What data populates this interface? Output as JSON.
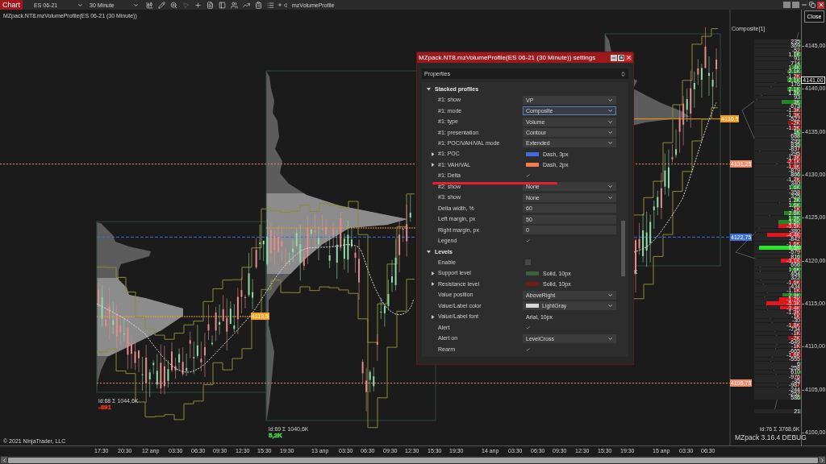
{
  "toolbar": {
    "tab": "Chart",
    "instrument": "ES 06-21",
    "interval": "30 Minute",
    "indicator": "mzVolumeProfile"
  },
  "close_button": "Close",
  "chart": {
    "indicator_label": "MZpack.NT8.mzVolumeProfile(ES 06-21 (30 Minute))",
    "composite_label": "Composite[1]",
    "price_tags": [
      {
        "text": "4136,5",
        "color": "#f39a1e"
      },
      {
        "text": "4131,25",
        "color": "#f08a6a"
      },
      {
        "text": "4122,75",
        "color": "#3d6fd6"
      },
      {
        "text": "4113,5",
        "color": "#f5a21c"
      },
      {
        "text": "4105,75",
        "color": "#f08a6a"
      }
    ],
    "profile_stats": [
      {
        "summary": "ld:68 Σ 1044,6K",
        "delta": "-891",
        "color": "#e0301e"
      },
      {
        "summary": "ld:69 Σ 1040,6K",
        "delta": "5,2K",
        "color": "#3ddc3d"
      },
      {
        "summary": "K"
      },
      {
        "summary": "ld:76 Σ 3768,6K"
      }
    ],
    "delta_column": [
      {
        "value": "235",
        "color": "#1a5c1a",
        "level": 0.04
      },
      {
        "value": "369",
        "color": "#1a5c1a",
        "level": 0.05
      },
      {
        "value": "-52",
        "color": "#5e1416",
        "level": 0.04
      },
      {
        "value": "1.1K",
        "color": "#1f8a1f",
        "level": 0.15
      },
      {
        "value": "91",
        "color": "#1a5c1a",
        "level": 0.04
      },
      {
        "value": "714",
        "color": "#1a5c1a",
        "level": 0.1
      },
      {
        "value": "1.4K",
        "color": "#1f8a1f",
        "level": 0.2
      },
      {
        "value": "2.1K",
        "color": "#1f8a1f",
        "level": 0.29
      },
      {
        "value": "-1.2K",
        "color": "#9c1518",
        "level": 0.16
      },
      {
        "value": "2.1K",
        "color": "#1f8a1f",
        "level": 0.29
      },
      {
        "value": "176",
        "color": "#1a5c1a",
        "level": 0.04
      },
      {
        "value": "2.1K",
        "color": "#1f8a1f",
        "level": 0.29
      },
      {
        "value": "1.2K",
        "color": "#1f8a1f",
        "level": 0.16
      },
      {
        "value": "93",
        "color": "#1a5c1a",
        "level": 0.04
      },
      {
        "value": "3K",
        "color": "#1f8a1f",
        "level": 0.41
      },
      {
        "value": "673",
        "color": "#1a5c1a",
        "level": 0.09
      },
      {
        "value": "-1.3K",
        "color": "#9c1518",
        "level": 0.18
      },
      {
        "value": "-1.3K",
        "color": "#9c1518",
        "level": 0.18
      },
      {
        "value": "-522",
        "color": "#5e1416",
        "level": 0.07
      },
      {
        "value": "-2K",
        "color": "#9c1518",
        "level": 0.28
      },
      {
        "value": "-1.5K",
        "color": "#9c1518",
        "level": 0.21
      },
      {
        "value": "1K",
        "color": "#1f8a1f",
        "level": 0.14
      },
      {
        "value": "688",
        "color": "#1a5c1a",
        "level": 0.1
      },
      {
        "value": "299",
        "color": "#1a5c1a",
        "level": 0.05
      },
      {
        "value": "835",
        "color": "#1a5c1a",
        "level": 0.12
      },
      {
        "value": "-837",
        "color": "#5e1416",
        "level": 0.12
      },
      {
        "value": "-295",
        "color": "#5e1416",
        "level": 0.05
      },
      {
        "value": "-1.3K",
        "color": "#9c1518",
        "level": 0.18
      },
      {
        "value": "-2.1K",
        "color": "#9c1518",
        "level": 0.29
      },
      {
        "value": "-1.9K",
        "color": "#9c1518",
        "level": 0.26
      },
      {
        "value": "-879",
        "color": "#5e1416",
        "level": 0.13
      },
      {
        "value": "866",
        "color": "#1a5c1a",
        "level": 0.12
      },
      {
        "value": "-1.2K",
        "color": "#9c1518",
        "level": 0.16
      },
      {
        "value": "340",
        "color": "#1a5c1a",
        "level": 0.05
      },
      {
        "value": "1.6K",
        "color": "#1f8a1f",
        "level": 0.23
      },
      {
        "value": "-358",
        "color": "#5e1416",
        "level": 0.05
      },
      {
        "value": "325",
        "color": "#1a5c1a",
        "level": 0.05
      },
      {
        "value": "1.2K",
        "color": "#1f8a1f",
        "level": 0.16
      },
      {
        "value": "1.6K",
        "color": "#1f8a1f",
        "level": 0.23
      },
      {
        "value": "-1K",
        "color": "#9c1518",
        "level": 0.14
      },
      {
        "value": "2.6K",
        "color": "#1f8a1f",
        "level": 0.36
      },
      {
        "value": "1.9K",
        "color": "#1f8a1f",
        "level": 0.26
      },
      {
        "value": "3.5K",
        "color": "#1f8a1f",
        "level": 0.49
      },
      {
        "value": "-3.5K",
        "color": "#e3161e",
        "level": 0.49
      },
      {
        "value": "-380",
        "color": "#5e1416",
        "level": 0.05
      },
      {
        "value": "-4.4K",
        "color": "#e3161e",
        "level": 0.72
      },
      {
        "value": "-842",
        "color": "#5e1416",
        "level": 0.12
      },
      {
        "value": "-1.6K",
        "color": "#9c1518",
        "level": 0.23
      },
      {
        "value": "6.5K",
        "color": "#27e627",
        "level": 0.9
      },
      {
        "value": "-579",
        "color": "#5e1416",
        "level": 0.08
      },
      {
        "value": "816",
        "color": "#1a5c1a",
        "level": 0.12
      },
      {
        "value": "-3.1K",
        "color": "#e3161e",
        "level": 0.43
      },
      {
        "value": "666",
        "color": "#1a5c1a",
        "level": 0.09
      },
      {
        "value": "1.6K",
        "color": "#1f8a1f",
        "level": 0.23
      },
      {
        "value": "454",
        "color": "#1a5c1a",
        "level": 0.06
      },
      {
        "value": "322",
        "color": "#1a5c1a",
        "level": 0.05
      },
      {
        "value": "-1.6K",
        "color": "#9c1518",
        "level": 0.23
      },
      {
        "value": "-434",
        "color": "#5e1416",
        "level": 0.06
      },
      {
        "value": "-1.1K",
        "color": "#9c1518",
        "level": 0.15
      },
      {
        "value": "2.9K",
        "color": "#1f8a1f",
        "level": 0.4
      },
      {
        "value": "-1.7K",
        "color": "#e3161e",
        "level": 0.47
      },
      {
        "value": "-5.3K",
        "color": "#e3161e",
        "level": 0.74
      },
      {
        "value": "-3.4K",
        "color": "#e3161e",
        "level": 0.45
      },
      {
        "value": "-1.3K",
        "color": "#9c1518",
        "level": 0.18
      },
      {
        "value": "-1K",
        "color": "#9c1518",
        "level": 0.14
      },
      {
        "value": "-30",
        "color": "#5e1416",
        "level": 0.04
      },
      {
        "value": "-1.8K",
        "color": "#9c1518",
        "level": 0.25
      },
      {
        "value": "-734",
        "color": "#5e1416",
        "level": 0.1
      },
      {
        "value": "-1K",
        "color": "#9c1518",
        "level": 0.14
      },
      {
        "value": "-2K",
        "color": "#9c1518",
        "level": 0.28
      },
      {
        "value": "-649",
        "color": "#5e1416",
        "level": 0.09
      },
      {
        "value": "-1K",
        "color": "#9c1518",
        "level": 0.14
      },
      {
        "value": "-665",
        "color": "#5e1416",
        "level": 0.09
      },
      {
        "value": "-1.6K",
        "color": "#9c1518",
        "level": 0.23
      },
      {
        "value": "-555",
        "color": "#5e1416",
        "level": 0.08
      },
      {
        "value": "6",
        "color": "#1a5c1a",
        "level": 0.04
      },
      {
        "value": "-258",
        "color": "#5e1416",
        "level": 0.04
      },
      {
        "value": "610",
        "color": "#1a5c1a",
        "level": 0.08
      },
      {
        "value": "-976",
        "color": "#5e1416",
        "level": 0.13
      },
      {
        "value": "-35",
        "color": "#5e1416",
        "level": 0.04
      },
      {
        "value": "-987",
        "color": "#5e1416",
        "level": 0.13
      },
      {
        "value": "-244",
        "color": "#5e1416",
        "level": 0.04
      },
      {
        "value": "-252",
        "color": "#5e1416",
        "level": 0.04
      },
      {
        "value": "586",
        "color": "#1a5c1a",
        "level": 0.08
      }
    ],
    "delta_column_tail": [
      {
        "value": "21",
        "color": "#1a5c1a",
        "level": 0.04
      }
    ],
    "copyright": "© 2021 NinjaTrader, LLC",
    "version": "MZpack 3.16.4 DEBUG"
  },
  "price_axis": {
    "labels": [
      "4145,00",
      "4140,00",
      "4135,00",
      "4130,00",
      "4125,00",
      "4120,00",
      "4115,00",
      "4110,00",
      "4105,00",
      "4100,00"
    ],
    "current_price": "4141,00"
  },
  "time_axis": {
    "labels": [
      "17:30",
      "20:30",
      "12 апр",
      "03:30",
      "06:30",
      "09:30",
      "12:30",
      "15:30",
      "19:30",
      "13 апр",
      "03:30",
      "06:30",
      "09:30",
      "12:30",
      "15:30",
      "19:30",
      "14 апр",
      "03:30",
      "06:30",
      "09:30",
      "12:30",
      "15:30",
      "19:30",
      "15 апр",
      "03:30",
      "06:30"
    ]
  },
  "settings": {
    "title": "MZpack.NT8.mzVolumeProfile(ES 06-21 (30 Minute)) settings",
    "header": "Properties",
    "groups": [
      {
        "label": "Stacked profiles",
        "expanded": true,
        "rows": [
          {
            "kind": "dropdown",
            "label": "#1: show",
            "value": "VP",
            "focused": false
          },
          {
            "kind": "dropdown",
            "label": "#1: mode",
            "value": "Composite",
            "focused": true
          },
          {
            "kind": "dropdown",
            "label": "#1: type",
            "value": "Volume",
            "focused": false
          },
          {
            "kind": "dropdown",
            "label": "#1: presentation",
            "value": "Contour",
            "focused": false
          },
          {
            "kind": "dropdown",
            "label": "#1: POC/VAH/VAL mode",
            "value": "Extended",
            "focused": false
          },
          {
            "kind": "stroke",
            "label": "#1: POC",
            "value": "Dash, 3px",
            "color": "#3b6ee0",
            "expanded": false,
            "focused": false
          },
          {
            "kind": "stroke",
            "label": "#1: VAH/VAL",
            "value": "Dash, 2px",
            "color": "#f47c50",
            "expanded": false,
            "focused": false
          },
          {
            "kind": "checkbox",
            "label": "#1: Delta",
            "checked": true,
            "focused": false
          },
          {
            "kind": "dropdown",
            "label": "#2: show",
            "value": "None",
            "focused": false
          },
          {
            "kind": "dropdown",
            "label": "#3: show",
            "value": "None",
            "focused": false
          },
          {
            "kind": "number",
            "label": "Delta width, %",
            "value": "60",
            "focused": false
          },
          {
            "kind": "number",
            "label": "Left margin, px",
            "value": "50",
            "focused": false
          },
          {
            "kind": "number",
            "label": "Right margin, px",
            "value": "0",
            "focused": false
          },
          {
            "kind": "checkbox",
            "label": "Legend",
            "checked": true,
            "focused": false
          }
        ]
      },
      {
        "label": "Levels",
        "expanded": true,
        "rows": [
          {
            "kind": "checkbox",
            "label": "Enable",
            "checked": false,
            "focused": false
          },
          {
            "kind": "stroke",
            "label": "Support level",
            "value": "Solid, 10px",
            "color": "#3f5f3f",
            "expanded": false,
            "focused": false
          },
          {
            "kind": "stroke",
            "label": "Resistance level",
            "value": "Solid, 10px",
            "color": "#6e1b1b",
            "expanded": false,
            "focused": false
          },
          {
            "kind": "dropdown",
            "label": "Value position",
            "value": "AboveRight",
            "focused": false
          },
          {
            "kind": "color_dropdown",
            "label": "Value/Label color",
            "value": "LightGray",
            "color": "#d8d8d8",
            "focused": false
          },
          {
            "kind": "text",
            "label": "Value/Label font",
            "value": "Arial, 10px",
            "expanded": false,
            "focused": false
          },
          {
            "kind": "checkbox",
            "label": "Alert",
            "checked": true,
            "focused": false
          },
          {
            "kind": "dropdown",
            "label": "Alert on",
            "value": "LevelCross",
            "focused": false
          },
          {
            "kind": "checkbox",
            "label": "Rearm",
            "checked": true,
            "focused": false
          }
        ]
      }
    ]
  }
}
